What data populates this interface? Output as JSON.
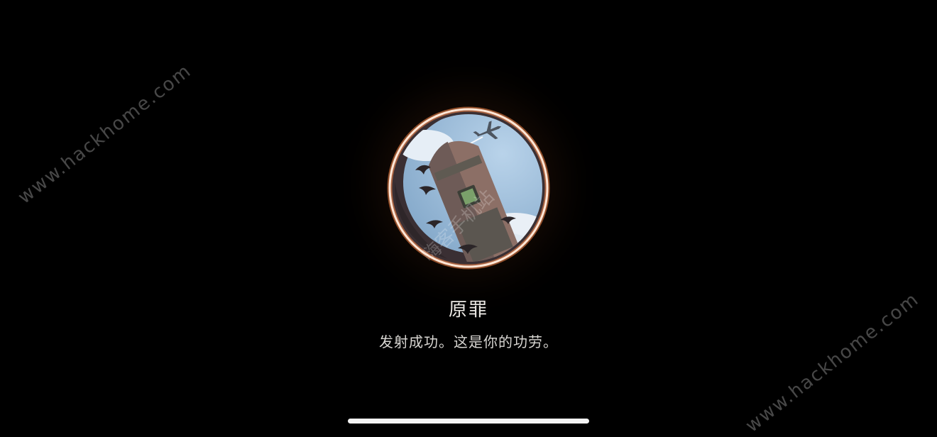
{
  "achievement": {
    "title": "原罪",
    "description": "发射成功。这是你的功劳。",
    "badge_icon": "rocket-launch-badge-icon"
  },
  "watermarks": {
    "top_left": "www.hackhome.com",
    "bottom_right": "www.hackhome.com",
    "center": "嗨客手机站"
  },
  "colors": {
    "background": "#000000",
    "ring": "#ffe2cf",
    "ring_glow": "#ff8a4a",
    "sky": "#9ebfdc",
    "rocket": "#8c6f66"
  }
}
